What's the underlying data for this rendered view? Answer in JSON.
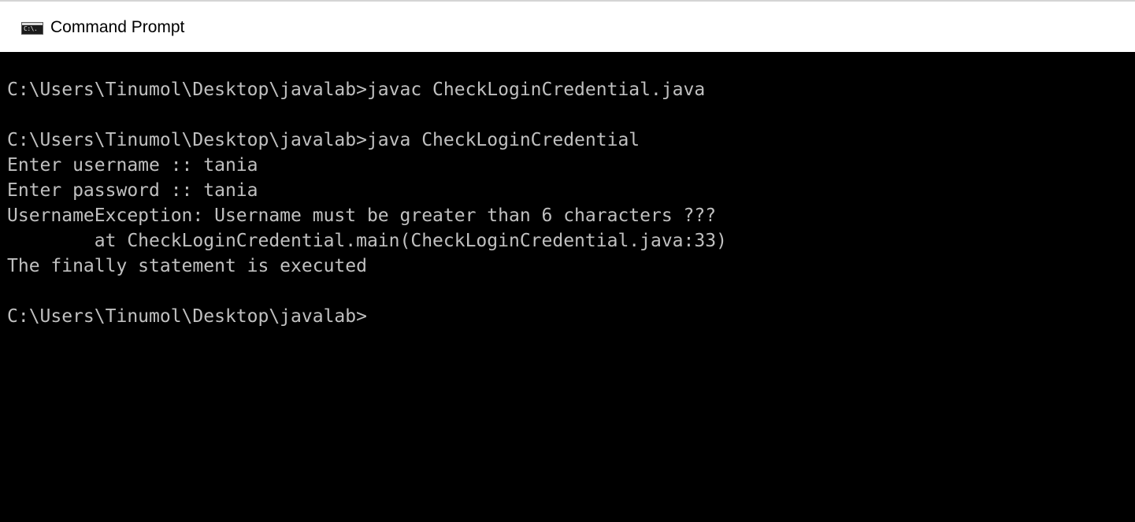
{
  "window": {
    "title": "Command Prompt",
    "icon": "console-icon",
    "icon_label": "C:\\."
  },
  "console": {
    "lines": [
      "C:\\Users\\Tinumol\\Desktop\\javalab>javac CheckLoginCredential.java",
      "",
      "C:\\Users\\Tinumol\\Desktop\\javalab>java CheckLoginCredential",
      "Enter username :: tania",
      "Enter password :: tania",
      "UsernameException: Username must be greater than 6 characters ???",
      "        at CheckLoginCredential.main(CheckLoginCredential.java:33)",
      "The finally statement is executed",
      "",
      "C:\\Users\\Tinumol\\Desktop\\javalab>"
    ]
  },
  "colors": {
    "console_background": "#000000",
    "console_text": "#c0c0c0",
    "titlebar_background": "#ffffff",
    "title_text": "#000000"
  }
}
